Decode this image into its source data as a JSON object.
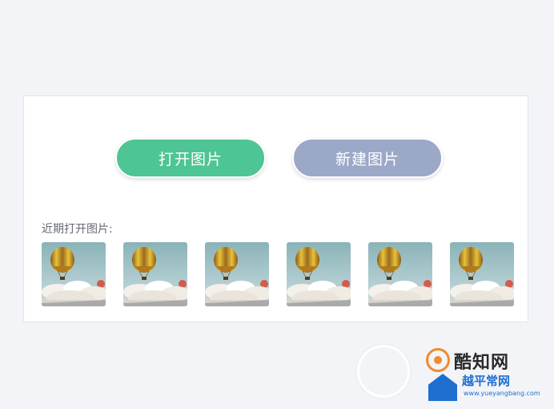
{
  "colors": {
    "background": "#f3f4f8",
    "panel": "#ffffff",
    "open_button": "#4ec594",
    "new_button": "#9ca8c8"
  },
  "buttons": {
    "open_label": "打开图片",
    "new_label": "新建图片"
  },
  "recent": {
    "label": "近期打开图片:",
    "thumbnails": [
      {
        "icon": "hot-air-balloon-image"
      },
      {
        "icon": "hot-air-balloon-image"
      },
      {
        "icon": "hot-air-balloon-image"
      },
      {
        "icon": "hot-air-balloon-image"
      },
      {
        "icon": "hot-air-balloon-image"
      },
      {
        "icon": "hot-air-balloon-image"
      }
    ]
  },
  "watermark": {
    "site_name": "酷知网",
    "badge_text": "越平常网",
    "url": "www.yueyangbang.com"
  }
}
